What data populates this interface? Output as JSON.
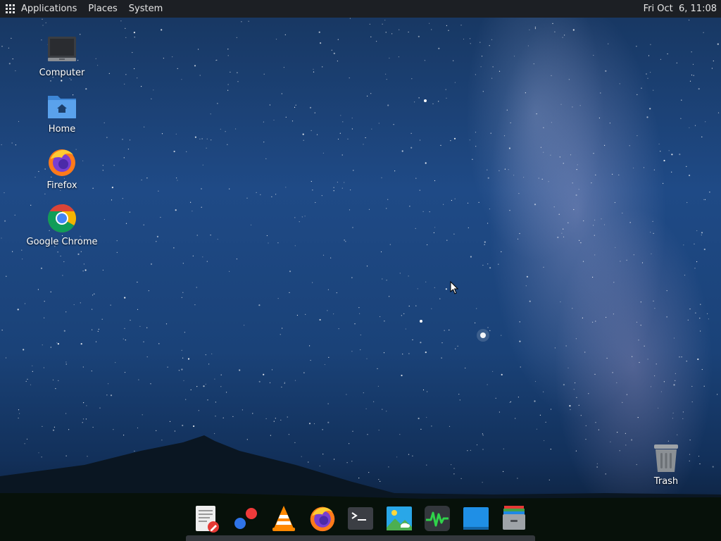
{
  "top_panel": {
    "applications_label": "Applications",
    "places_label": "Places",
    "system_label": "System",
    "clock": "Fri Oct  6, 11:08"
  },
  "desktop_icons": [
    {
      "label": "Computer",
      "icon": "computer-icon"
    },
    {
      "label": "Home",
      "icon": "home-folder-icon"
    },
    {
      "label": "Firefox",
      "icon": "firefox-icon"
    },
    {
      "label": "Google Chrome",
      "icon": "chrome-icon"
    },
    {
      "label": "Trash",
      "icon": "trash-icon"
    }
  ],
  "dock_items": [
    {
      "icon": "text-editor-icon"
    },
    {
      "icon": "color-dots-app-icon"
    },
    {
      "icon": "vlc-icon"
    },
    {
      "icon": "firefox-icon"
    },
    {
      "icon": "terminal-icon"
    },
    {
      "icon": "image-viewer-icon"
    },
    {
      "icon": "system-monitor-icon"
    },
    {
      "icon": "blue-window-icon"
    },
    {
      "icon": "archive-manager-icon"
    }
  ],
  "colors": {
    "panel_bg": "#1c1f24",
    "sky_top": "#173660",
    "sky_mid": "#1f4a86",
    "ground": "#0b1a30"
  }
}
